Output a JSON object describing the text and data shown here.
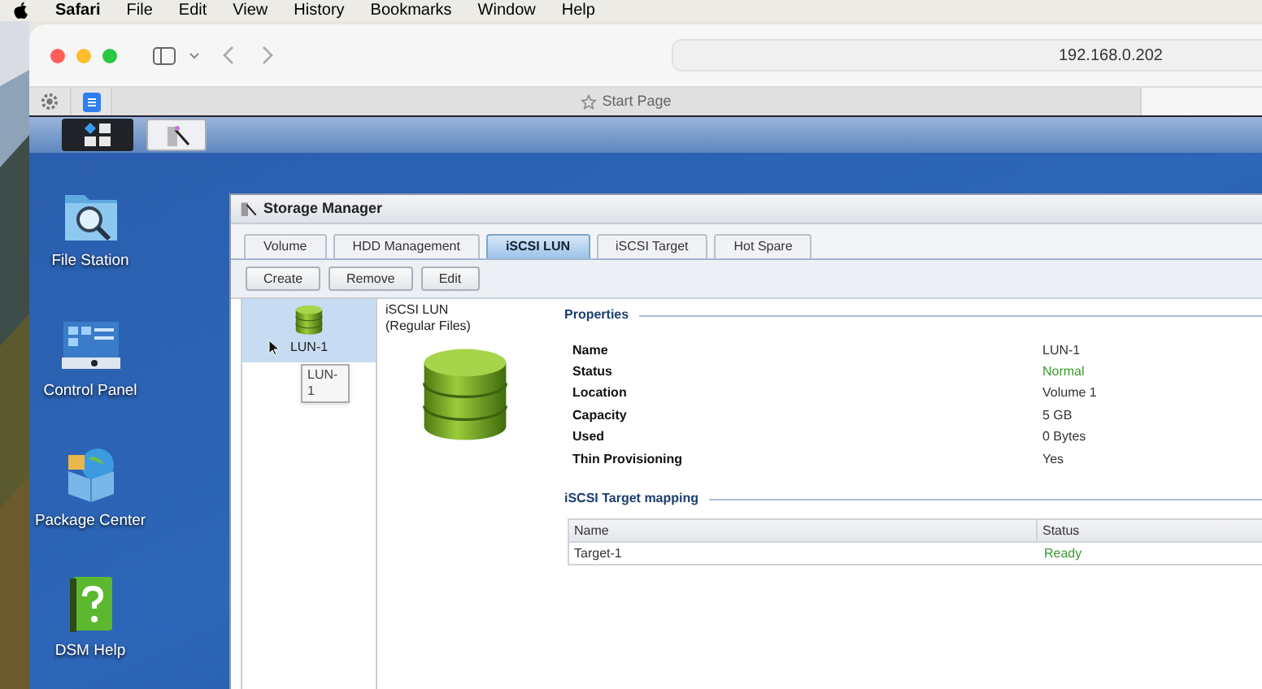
{
  "menu_bar": {
    "app": "Safari",
    "items": [
      "File",
      "Edit",
      "View",
      "History",
      "Bookmarks",
      "Window",
      "Help"
    ]
  },
  "browser": {
    "address": "192.168.0.202",
    "tab": "Start Page"
  },
  "taskbar": [
    {
      "kind": "main-menu",
      "selected": true
    },
    {
      "kind": "storage",
      "selected": false
    }
  ],
  "desktop_icons": [
    {
      "kind": "file",
      "label": "File Station"
    },
    {
      "kind": "control",
      "label": "Control Panel"
    },
    {
      "kind": "package",
      "label": "Package Center"
    },
    {
      "kind": "help",
      "label": "DSM Help"
    }
  ],
  "window": {
    "title": "Storage Manager",
    "tabs": [
      {
        "label": "Volume",
        "selected": false
      },
      {
        "label": "HDD Management",
        "selected": false
      },
      {
        "label": "iSCSI LUN",
        "selected": true
      },
      {
        "label": "iSCSI Target",
        "selected": false
      },
      {
        "label": "Hot Spare",
        "selected": false
      }
    ],
    "toolbar": [
      "Create",
      "Remove",
      "Edit"
    ],
    "lun_list": [
      {
        "label": "LUN-1",
        "selected": true
      }
    ],
    "tooltip": "LUN-1",
    "detail": {
      "type_title": "iSCSI LUN",
      "type_subtitle": "(Regular Files)"
    },
    "properties": {
      "title": "Properties",
      "rows": [
        {
          "label": "Name",
          "value": "LUN-1",
          "kind": "text"
        },
        {
          "label": "Status",
          "value": "Normal",
          "kind": "status"
        },
        {
          "label": "Location",
          "value": "Volume 1",
          "kind": "text"
        },
        {
          "label": "Capacity",
          "value": "5 GB",
          "kind": "text"
        },
        {
          "label": "Used",
          "value": "0 Bytes",
          "kind": "text"
        },
        {
          "label": "Thin Provisioning",
          "value": "Yes",
          "kind": "text"
        }
      ]
    },
    "mapping": {
      "title": "iSCSI Target mapping",
      "columns": [
        "Name",
        "Status"
      ],
      "rows": [
        {
          "name": "Target-1",
          "status": "Ready"
        }
      ]
    }
  }
}
